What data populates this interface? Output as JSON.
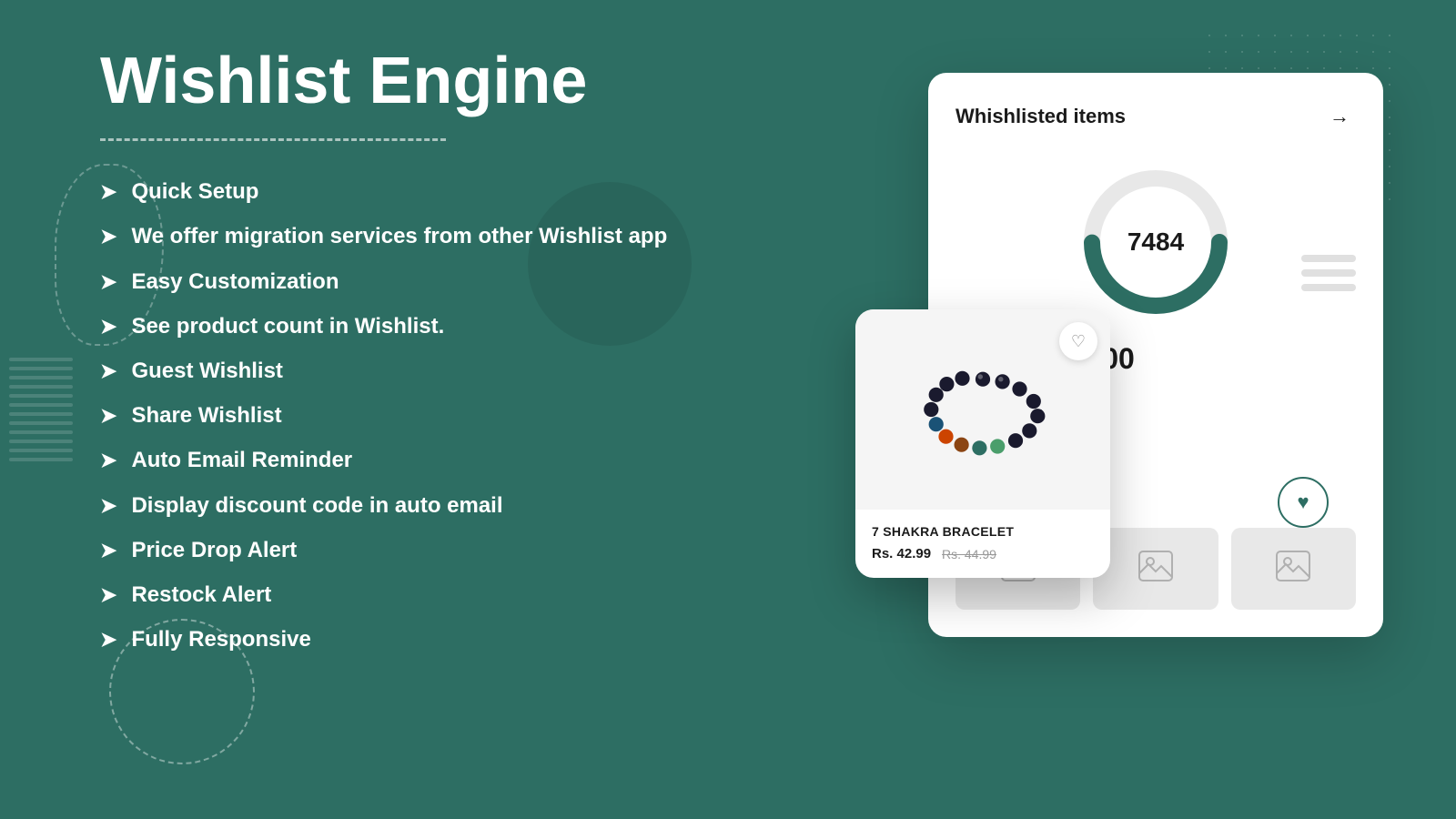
{
  "page": {
    "title": "Wishlist Engine",
    "background_color": "#2d6e63"
  },
  "header": {
    "title": "Wishlist Engine",
    "underline_visible": true
  },
  "features": {
    "items": [
      {
        "id": "quick-setup",
        "text": "Quick Setup"
      },
      {
        "id": "migration",
        "text": "We offer migration services from other Wishlist app"
      },
      {
        "id": "customization",
        "text": "Easy Customization"
      },
      {
        "id": "product-count",
        "text": "See product count in Wishlist."
      },
      {
        "id": "guest-wishlist",
        "text": "Guest Wishlist"
      },
      {
        "id": "share-wishlist",
        "text": "Share Wishlist"
      },
      {
        "id": "auto-email",
        "text": "Auto Email Reminder"
      },
      {
        "id": "discount-code",
        "text": "Display discount code in auto email"
      },
      {
        "id": "price-drop",
        "text": "Price Drop Alert"
      },
      {
        "id": "restock",
        "text": "Restock Alert"
      },
      {
        "id": "responsive",
        "text": "Fully Responsive"
      }
    ],
    "arrow_symbol": "➤"
  },
  "dashboard": {
    "title": "Whishlisted items",
    "arrow_icon": "→",
    "count_display": "7484",
    "count_fraction": "7484 / 10000",
    "donut": {
      "value": 7484,
      "max": 10000,
      "color": "#2d6e63",
      "bg_color": "#e8e8e8",
      "stroke_width": 18,
      "radius": 70
    }
  },
  "product_card": {
    "name": "7 SHAKRA BRACELET",
    "price_current": "Rs. 42.99",
    "price_original": "Rs. 44.99",
    "wishlist_button_icon": "♡"
  },
  "thumbnails": [
    {
      "id": "thumb-1",
      "icon": "🖼"
    },
    {
      "id": "thumb-2",
      "icon": "🖼"
    },
    {
      "id": "thumb-3",
      "icon": "🖼"
    }
  ]
}
